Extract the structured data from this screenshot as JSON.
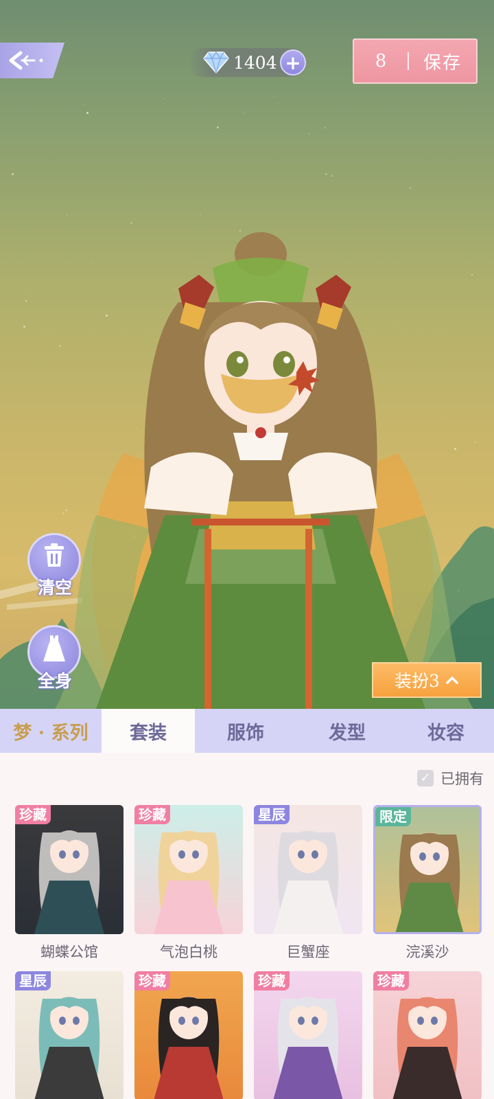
{
  "topbar": {
    "gem_count": "1404",
    "gem_plus": "+",
    "save_count": "8",
    "save_label": "保存"
  },
  "side_buttons": {
    "clear_label": "清空",
    "fullbody_label": "全身"
  },
  "outfit_button": {
    "label": "装扮3",
    "chevron": "⌃"
  },
  "tabs": [
    {
      "label": "梦 · 系列"
    },
    {
      "label": "套装"
    },
    {
      "label": "服饰"
    },
    {
      "label": "发型"
    },
    {
      "label": "妆容"
    }
  ],
  "filter": {
    "owned_label": "已拥有",
    "owned_check": "✓"
  },
  "cards": [
    {
      "name": "蝴蝶公馆",
      "badge": "珍藏",
      "badge_color": "#f07fa3",
      "bg": [
        "#3a3a3c",
        "#2a2f36"
      ],
      "hair": "#bfbcbc",
      "dress": "#2f4f56"
    },
    {
      "name": "气泡白桃",
      "badge": "珍藏",
      "badge_color": "#f07fa3",
      "bg": [
        "#cdeee8",
        "#f6d3d8"
      ],
      "hair": "#f0d39a",
      "dress": "#f7c3cf"
    },
    {
      "name": "巨蟹座",
      "badge": "星辰",
      "badge_color": "#8d86e0",
      "bg": [
        "#f4e6e2",
        "#efe6f2"
      ],
      "hair": "#dedbe0",
      "dress": "#f5f0f0"
    },
    {
      "name": "浣溪沙",
      "badge": "限定",
      "badge_color": "#5bb59b",
      "bg": [
        "#aec19a",
        "#e0c37a"
      ],
      "hair": "#9a7a4e",
      "dress": "#5e8a45"
    },
    {
      "name": "",
      "badge": "星辰",
      "badge_color": "#8d86e0",
      "bg": [
        "#f3ece0",
        "#e8e0d3"
      ],
      "hair": "#7cbcb8",
      "dress": "#3b3b3b"
    },
    {
      "name": "",
      "badge": "珍藏",
      "badge_color": "#f07fa3",
      "bg": [
        "#f0a64e",
        "#e9893b"
      ],
      "hair": "#2a2423",
      "dress": "#b83a33"
    },
    {
      "name": "",
      "badge": "珍藏",
      "badge_color": "#f07fa3",
      "bg": [
        "#f3d6ee",
        "#e8c0e0"
      ],
      "hair": "#e5e3ea",
      "dress": "#7b57a8"
    },
    {
      "name": "",
      "badge": "珍藏",
      "badge_color": "#f07fa3",
      "bg": [
        "#f6d2d6",
        "#f0c0c4"
      ],
      "hair": "#e98670",
      "dress": "#3b2c2c"
    }
  ]
}
